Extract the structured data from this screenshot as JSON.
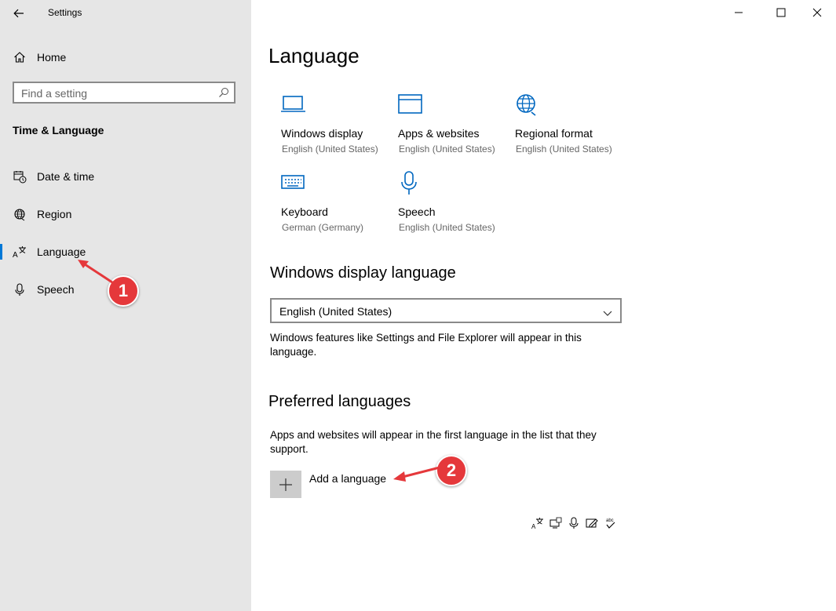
{
  "window": {
    "title": "Settings"
  },
  "sidebar": {
    "home_label": "Home",
    "search_placeholder": "Find a setting",
    "section_title": "Time & Language",
    "items": [
      {
        "label": "Date & time",
        "icon": "calendar-clock-icon"
      },
      {
        "label": "Region",
        "icon": "globe-icon"
      },
      {
        "label": "Language",
        "icon": "language-icon",
        "selected": true
      },
      {
        "label": "Speech",
        "icon": "microphone-icon"
      }
    ]
  },
  "main": {
    "title": "Language",
    "tiles": [
      {
        "name": "Windows display",
        "sub": "English (United States)",
        "icon": "monitor-icon"
      },
      {
        "name": "Apps & websites",
        "sub": "English (United States)",
        "icon": "browser-window-icon"
      },
      {
        "name": "Regional format",
        "sub": "English (United States)",
        "icon": "globe-icon"
      },
      {
        "name": "Keyboard",
        "sub": "German (Germany)",
        "icon": "keyboard-icon"
      },
      {
        "name": "Speech",
        "sub": "English (United States)",
        "icon": "microphone-icon"
      }
    ],
    "display_language": {
      "heading": "Windows display language",
      "selected": "English (United States)",
      "description": "Windows features like Settings and File Explorer will appear in this language."
    },
    "preferred": {
      "heading": "Preferred languages",
      "description": "Apps and websites will appear in the first language in the list that they support.",
      "add_label": "Add a language"
    },
    "feature_icons": [
      "language-pack-icon",
      "display-language-icon",
      "speech-icon",
      "handwriting-icon",
      "spelling-icon"
    ]
  },
  "annotations": {
    "badge_1": "1",
    "badge_2": "2",
    "color": "#e5383b"
  },
  "colors": {
    "accent": "#0078d7",
    "sidebar_bg": "#e6e6e6",
    "add_button_bg": "#cccccc"
  }
}
